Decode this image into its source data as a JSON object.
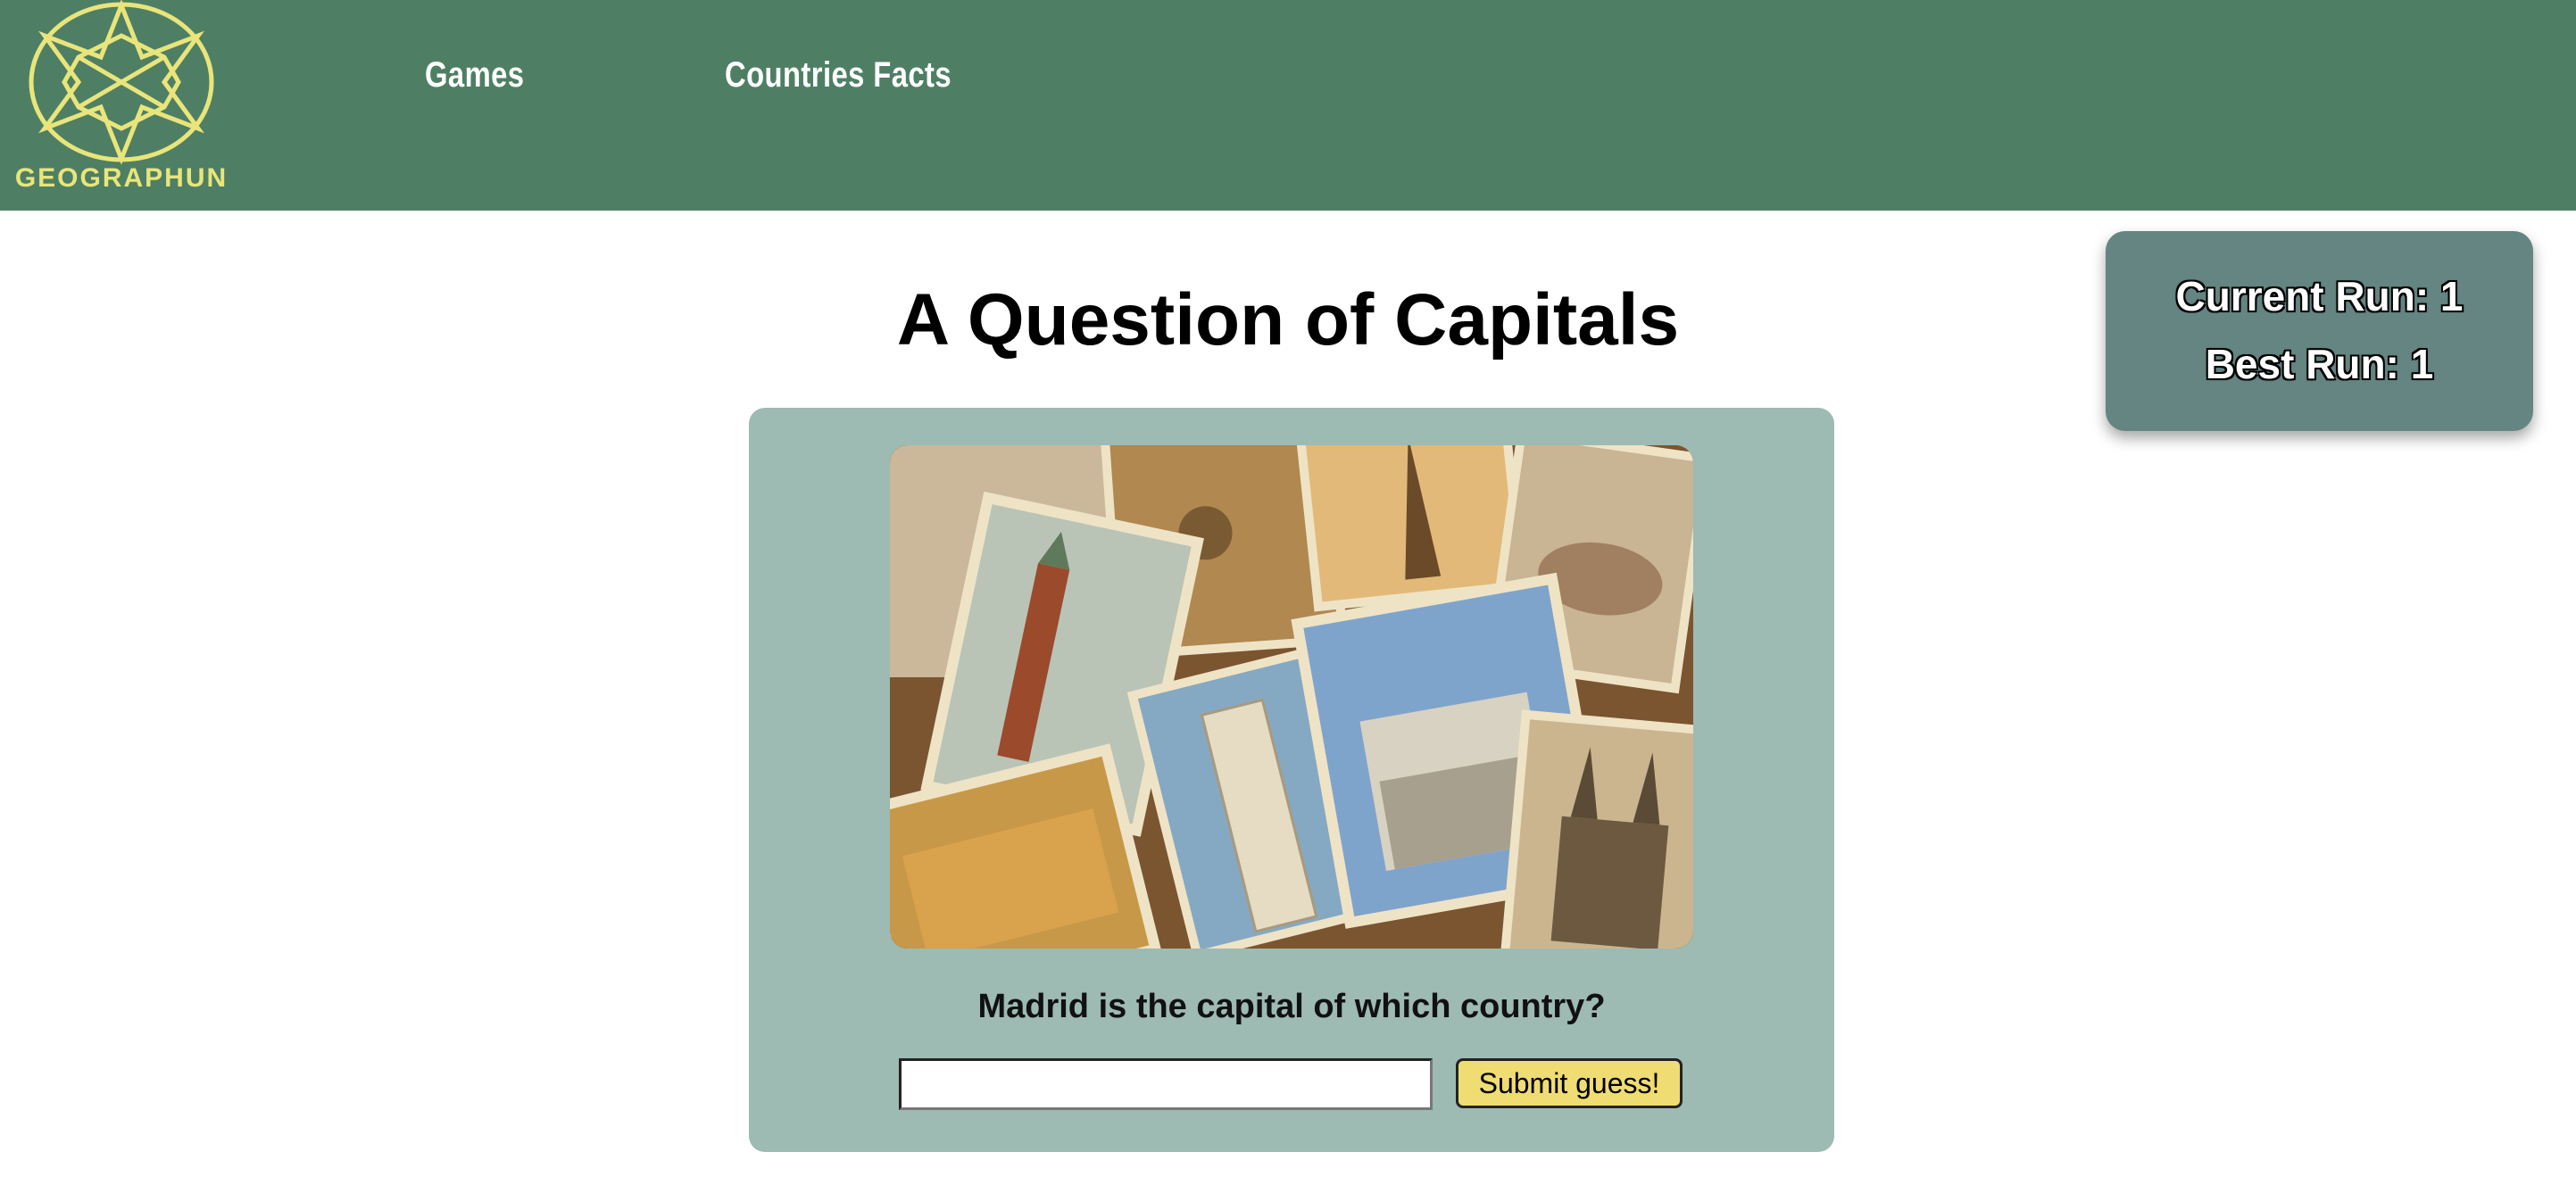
{
  "brand": {
    "name": "GEOGRAPHUN",
    "color": "#e9e57a"
  },
  "nav": {
    "items": [
      {
        "label": "Games"
      },
      {
        "label": "Countries Facts"
      }
    ]
  },
  "score": {
    "current": "Current Run: 1",
    "best": "Best Run: 1"
  },
  "main": {
    "title": "A Question of Capitals",
    "image_icon": "vintage-landmark-postcards-image",
    "question": "Madrid is the capital of which country?",
    "answer_value": "",
    "submit_label": "Submit guess!"
  },
  "colors": {
    "header": "#4e7f65",
    "card": "#9dbab3",
    "score_box": "#658582",
    "button": "#efdc73"
  }
}
